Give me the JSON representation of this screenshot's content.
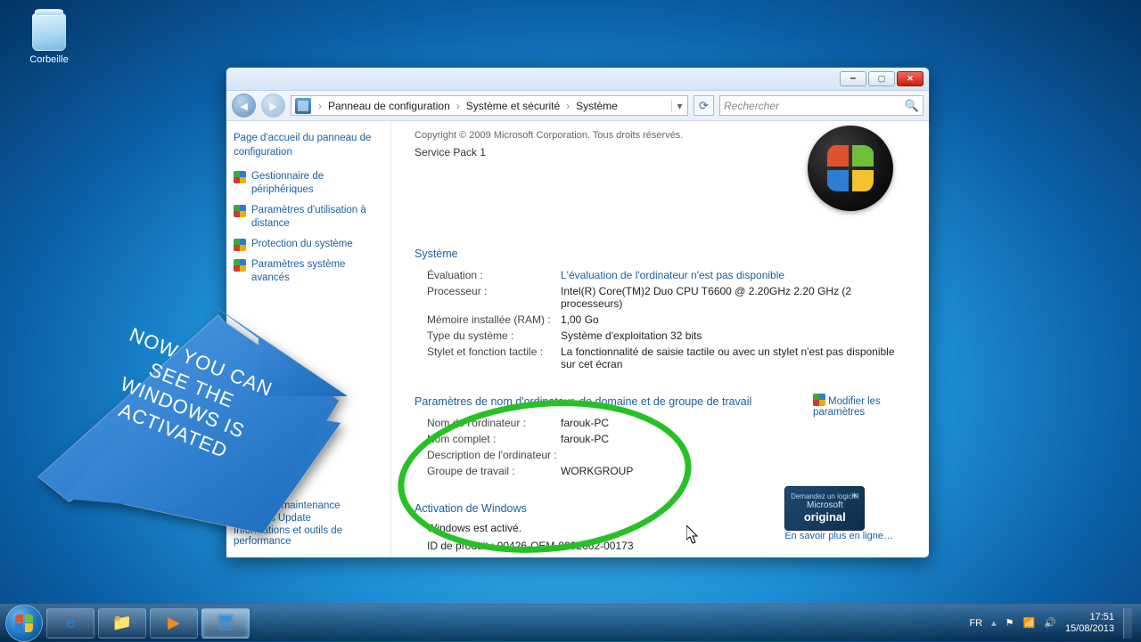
{
  "desktop": {
    "recycle": "Corbeille"
  },
  "window": {
    "breadcrumb": {
      "root": "Panneau de configuration",
      "mid": "Système et sécurité",
      "leaf": "Système"
    },
    "search_placeholder": "Rechercher",
    "sidebar": {
      "home": "Page d'accueil du panneau de configuration",
      "items": [
        "Gestionnaire de périphériques",
        "Paramètres d'utilisation à distance",
        "Protection du système",
        "Paramètres système avancés"
      ],
      "bottom": [
        "Centre de maintenance",
        "Windows Update",
        "Informations et outils de performance"
      ]
    },
    "content": {
      "copyright": "Copyright © 2009 Microsoft Corporation. Tous droits réservés.",
      "service_pack": "Service Pack 1",
      "sections": {
        "system_title": "Système",
        "system": {
          "eval_k": "Évaluation :",
          "eval_v": "L'évaluation de l'ordinateur n'est pas disponible",
          "proc_k": "Processeur :",
          "proc_v": "Intel(R) Core(TM)2 Duo CPU     T6600  @ 2.20GHz   2.20 GHz  (2 processeurs)",
          "ram_k": "Mémoire installée (RAM) :",
          "ram_v": "1,00 Go",
          "type_k": "Type du système :",
          "type_v": "Système d'exploitation 32 bits",
          "pen_k": "Stylet et fonction tactile :",
          "pen_v": "La fonctionnalité de saisie tactile ou avec un stylet n'est pas disponible sur cet écran"
        },
        "computer_title": "Paramètres de nom d'ordinateur, de domaine et de groupe de travail",
        "computer": {
          "name_k": "Nom de l'ordinateur :",
          "name_v": "farouk-PC",
          "full_k": "Nom complet :",
          "full_v": "farouk-PC",
          "desc_k": "Description de l'ordinateur :",
          "desc_v": "",
          "wg_k": "Groupe de travail :",
          "wg_v": "WORKGROUP",
          "modify": "Modifier les paramètres"
        },
        "activation_title": "Activation de Windows",
        "activation": {
          "status": "Windows est activé.",
          "pid": "ID de produit : 00426-OEM-8992662-00173"
        },
        "genuine": {
          "line1": "Demandez un logiciel",
          "line2": "Microsoft",
          "line3": "original",
          "more": "En savoir plus en ligne…"
        }
      }
    }
  },
  "annotation": {
    "arrow_text": "NOW YOU CAN SEE THE WINDOWS IS ACTIVATED"
  },
  "taskbar": {
    "lang": "FR",
    "time": "17:51",
    "date": "15/08/2013"
  }
}
